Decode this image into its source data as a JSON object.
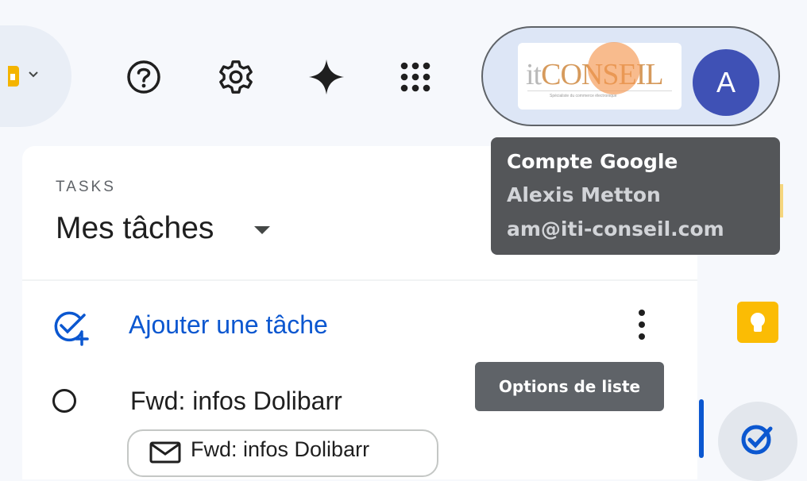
{
  "toolbar": {
    "help_label": "Aide",
    "settings_label": "Paramètres",
    "gemini_label": "Gemini",
    "apps_label": "Applications Google"
  },
  "account": {
    "logo_text_it": "it",
    "logo_text_conseil": "CONSEIL",
    "logo_tagline": "Spécialiste du commerce électronique",
    "avatar_letter": "A",
    "tooltip_title": "Compte Google",
    "tooltip_name": "Alexis Metton",
    "tooltip_email": "am@iti-conseil.com"
  },
  "tasks": {
    "section_label": "TASKS",
    "list_title": "Mes tâches",
    "add_task_label": "Ajouter une tâche",
    "list_options_tooltip": "Options de liste",
    "items": [
      {
        "title": "Fwd: infos Dolibarr",
        "chip_label": "Fwd: infos Dolibarr"
      }
    ]
  },
  "colors": {
    "accent": "#0b57d0",
    "avatar": "#3f51b5",
    "keep": "#fbbc04",
    "tooltip_bg": "#545659"
  }
}
